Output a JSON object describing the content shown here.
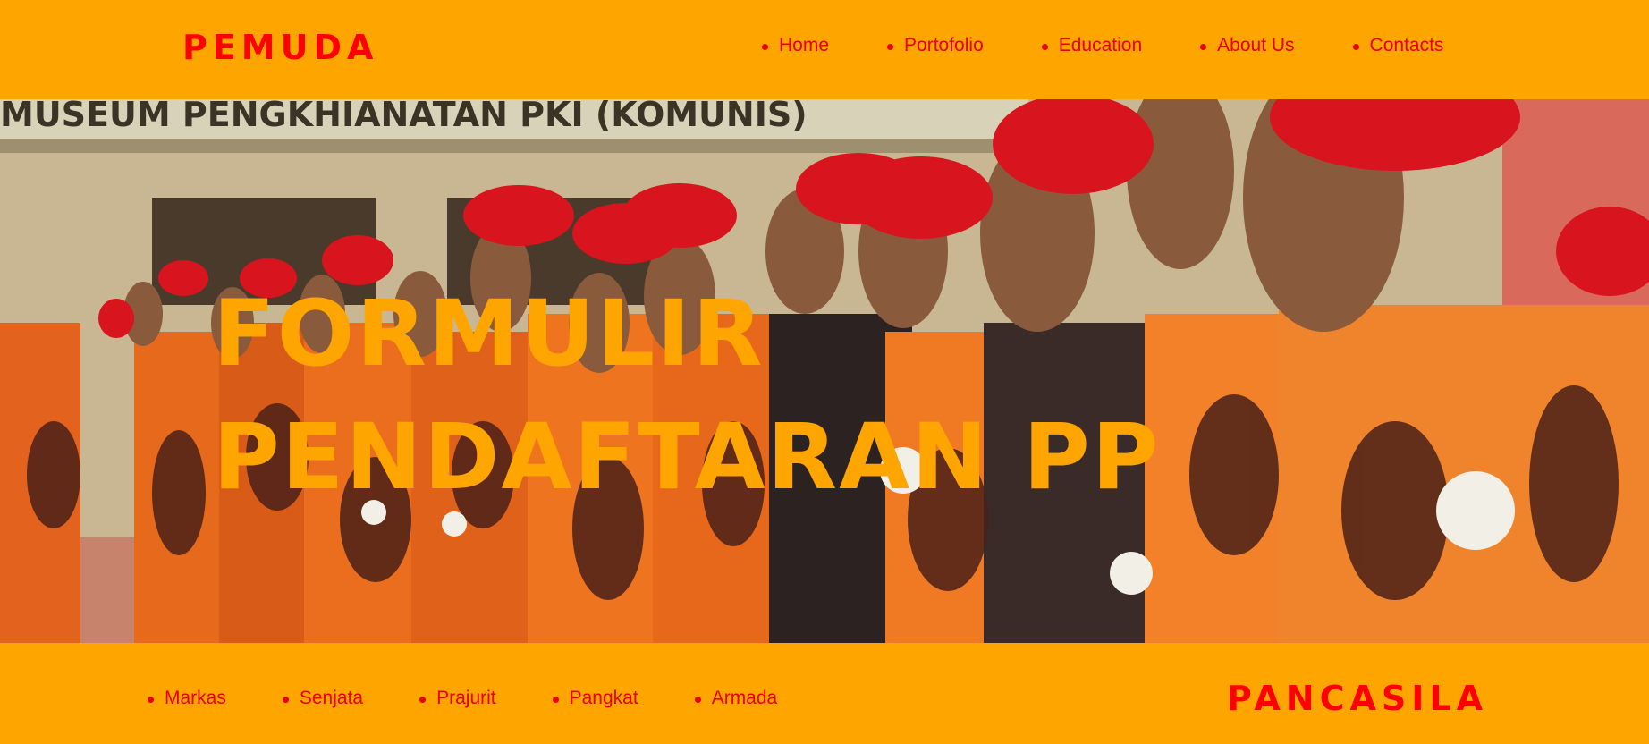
{
  "header": {
    "brand": "PEMUDA",
    "nav": [
      "Home",
      "Portofolio",
      "Education",
      "About Us",
      "Contacts"
    ]
  },
  "hero": {
    "banner_text": "MUSEUM PENGKHIANATAN PKI (KOMUNIS)",
    "title": "FORMULIR PENDAFTARAN PP",
    "image": "photo of members in orange camouflage uniforms and red berets standing in a line"
  },
  "footer": {
    "nav": [
      "Markas",
      "Senjata",
      "Prajurit",
      "Pangkat",
      "Armada"
    ],
    "brand": "PANCASILA"
  },
  "colors": {
    "bar": "#ffa500",
    "link": "#e8000b",
    "brand": "#ff0000",
    "title": "#ffa500"
  }
}
